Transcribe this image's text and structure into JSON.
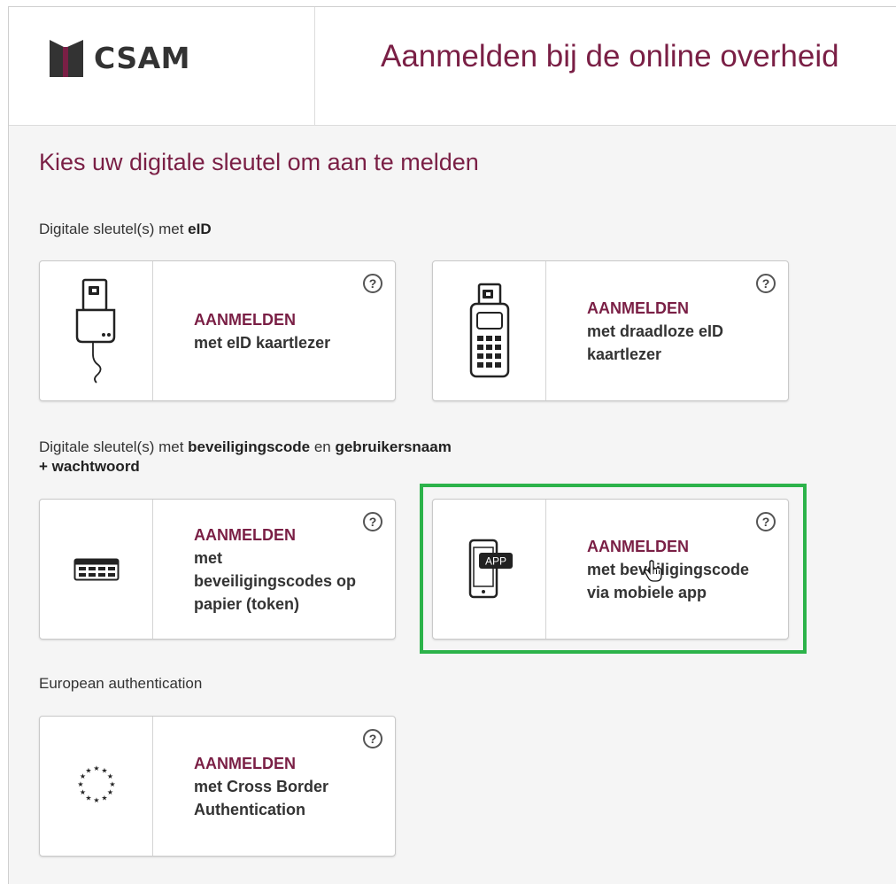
{
  "header": {
    "logo_text": "CSAM",
    "title": "Aanmelden bij de online overheid"
  },
  "page": {
    "heading": "Kies uw digitale sleutel om aan te melden"
  },
  "sections": {
    "eid": {
      "prefix": "Digitale sleutel(s) met ",
      "bold": "eID"
    },
    "code": {
      "prefix": "Digitale sleutel(s) met ",
      "bold1": "beveiligingscode",
      "middle": " en ",
      "bold2": "gebruikersnaam",
      "line2": "+ wachtwoord"
    },
    "european": {
      "label": "European authentication"
    }
  },
  "cards": {
    "eid_reader": {
      "cta": "AANMELDEN",
      "desc": "met eID kaartlezer",
      "help": "?",
      "icon": "card-reader-icon"
    },
    "wireless_reader": {
      "cta": "AANMELDEN",
      "desc": "met draadloze eID kaartlezer",
      "help": "?",
      "icon": "wireless-reader-icon"
    },
    "token": {
      "cta": "AANMELDEN",
      "desc": "met beveiligingscodes op papier (token)",
      "help": "?",
      "icon": "token-card-icon"
    },
    "mobile_app": {
      "cta": "AANMELDEN",
      "desc": "met beveiligingscode via mobiele app",
      "help": "?",
      "icon": "mobile-app-icon",
      "app_badge": "APP"
    },
    "cross_border": {
      "cta": "AANMELDEN",
      "desc": "met Cross Border Authentication",
      "help": "?",
      "icon": "eu-stars-icon"
    }
  },
  "colors": {
    "brand": "#7a1f45",
    "highlight": "#2cb34a"
  }
}
